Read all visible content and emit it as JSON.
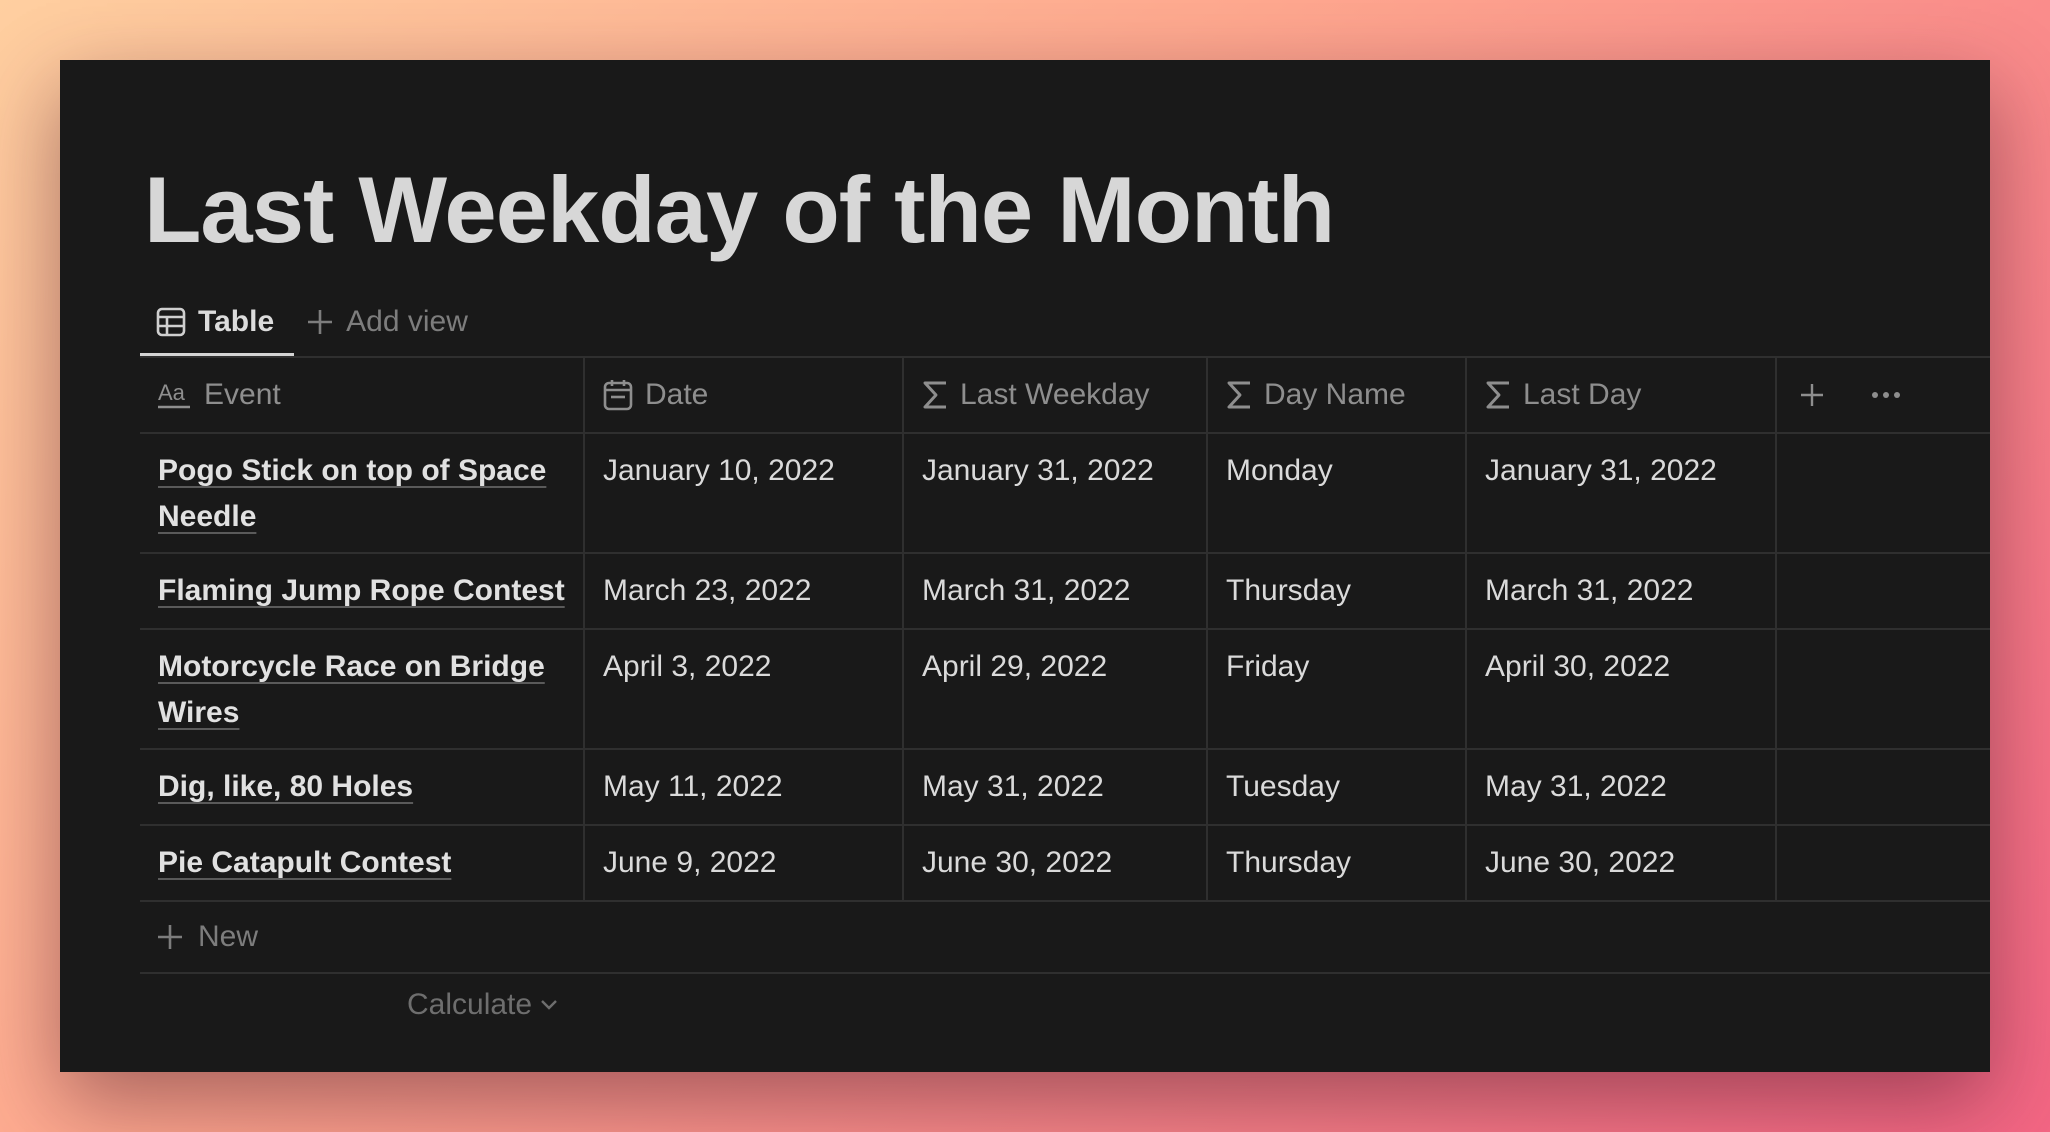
{
  "page": {
    "title": "Last Weekday of the Month"
  },
  "views": {
    "table_tab": {
      "label": "Table",
      "icon": "table-icon"
    },
    "add_view": {
      "label": "Add view",
      "icon": "plus-icon"
    }
  },
  "table": {
    "columns": [
      {
        "label": "Event",
        "icon": "text-property-icon"
      },
      {
        "label": "Date",
        "icon": "calendar-icon"
      },
      {
        "label": "Last Weekday",
        "icon": "formula-sigma-icon"
      },
      {
        "label": "Day Name",
        "icon": "formula-sigma-icon"
      },
      {
        "label": "Last Day",
        "icon": "formula-sigma-icon"
      }
    ],
    "rows": [
      {
        "event": "Pogo Stick on top of Space Needle",
        "date": "January 10, 2022",
        "last_weekday": "January 31, 2022",
        "day_name": "Monday",
        "last_day": "January 31, 2022"
      },
      {
        "event": "Flaming Jump Rope Contest",
        "date": "March 23, 2022",
        "last_weekday": "March 31, 2022",
        "day_name": "Thursday",
        "last_day": "March 31, 2022"
      },
      {
        "event": "Motorcycle Race on Bridge Wires",
        "date": "April 3, 2022",
        "last_weekday": "April 29, 2022",
        "day_name": "Friday",
        "last_day": "April 30, 2022"
      },
      {
        "event": "Dig, like, 80 Holes",
        "date": "May 11, 2022",
        "last_weekday": "May 31, 2022",
        "day_name": "Tuesday",
        "last_day": "May 31, 2022"
      },
      {
        "event": "Pie Catapult Contest",
        "date": "June 9, 2022",
        "last_weekday": "June 30, 2022",
        "day_name": "Thursday",
        "last_day": "June 30, 2022"
      }
    ],
    "new_row_label": "New",
    "calculate_label": "Calculate"
  },
  "colors": {
    "background": "#191919",
    "text": "#d7d7d7",
    "muted": "#7d7d7d",
    "border": "#2f2f2f"
  }
}
